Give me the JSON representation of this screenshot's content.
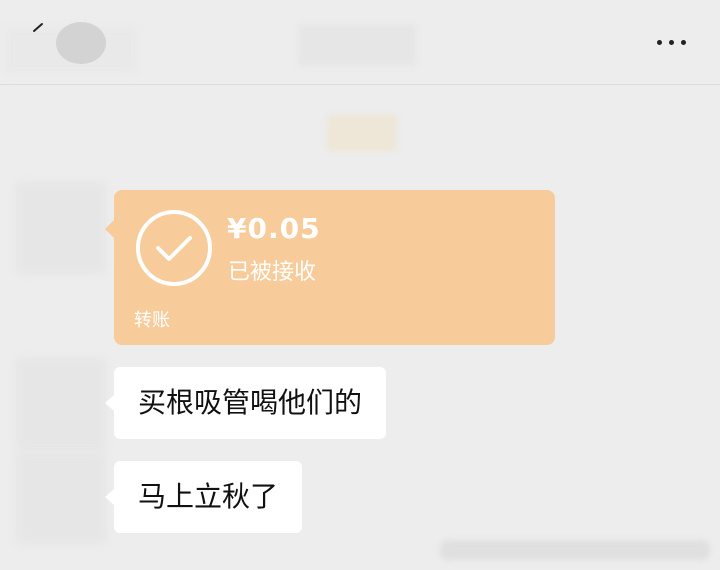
{
  "header": {
    "back_icon": "back-chevron-icon",
    "more_icon": "more-dots-icon"
  },
  "transfer": {
    "amount": "¥0.05",
    "status": "已被接收",
    "label": "转账",
    "icon": "check-circle-icon",
    "color": "#f8cb9a"
  },
  "messages": [
    {
      "text": "买根吸管喝他们的"
    },
    {
      "text": "马上立秋了"
    }
  ],
  "colors": {
    "background": "#ededed",
    "bubble": "#ffffff",
    "transfer_card": "#f8cb9a"
  }
}
